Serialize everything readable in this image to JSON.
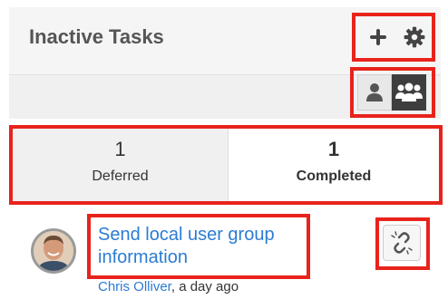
{
  "dashlet": {
    "title": "Inactive Tasks",
    "icons": {
      "add": "plus-icon",
      "settings": "gear-icon",
      "my_items": "user-icon",
      "team_items": "users-icon",
      "unlink": "unlink-icon"
    },
    "tabs": [
      {
        "count": "1",
        "label": "Deferred"
      },
      {
        "count": "1",
        "label": "Completed"
      }
    ],
    "task": {
      "title": "Send local user group information",
      "author": "Chris Olliver",
      "time": ", a day ago"
    }
  },
  "colors": {
    "highlight": "#e8231c",
    "link": "#2b7cd3",
    "active_toggle": "#3e3e3e"
  }
}
